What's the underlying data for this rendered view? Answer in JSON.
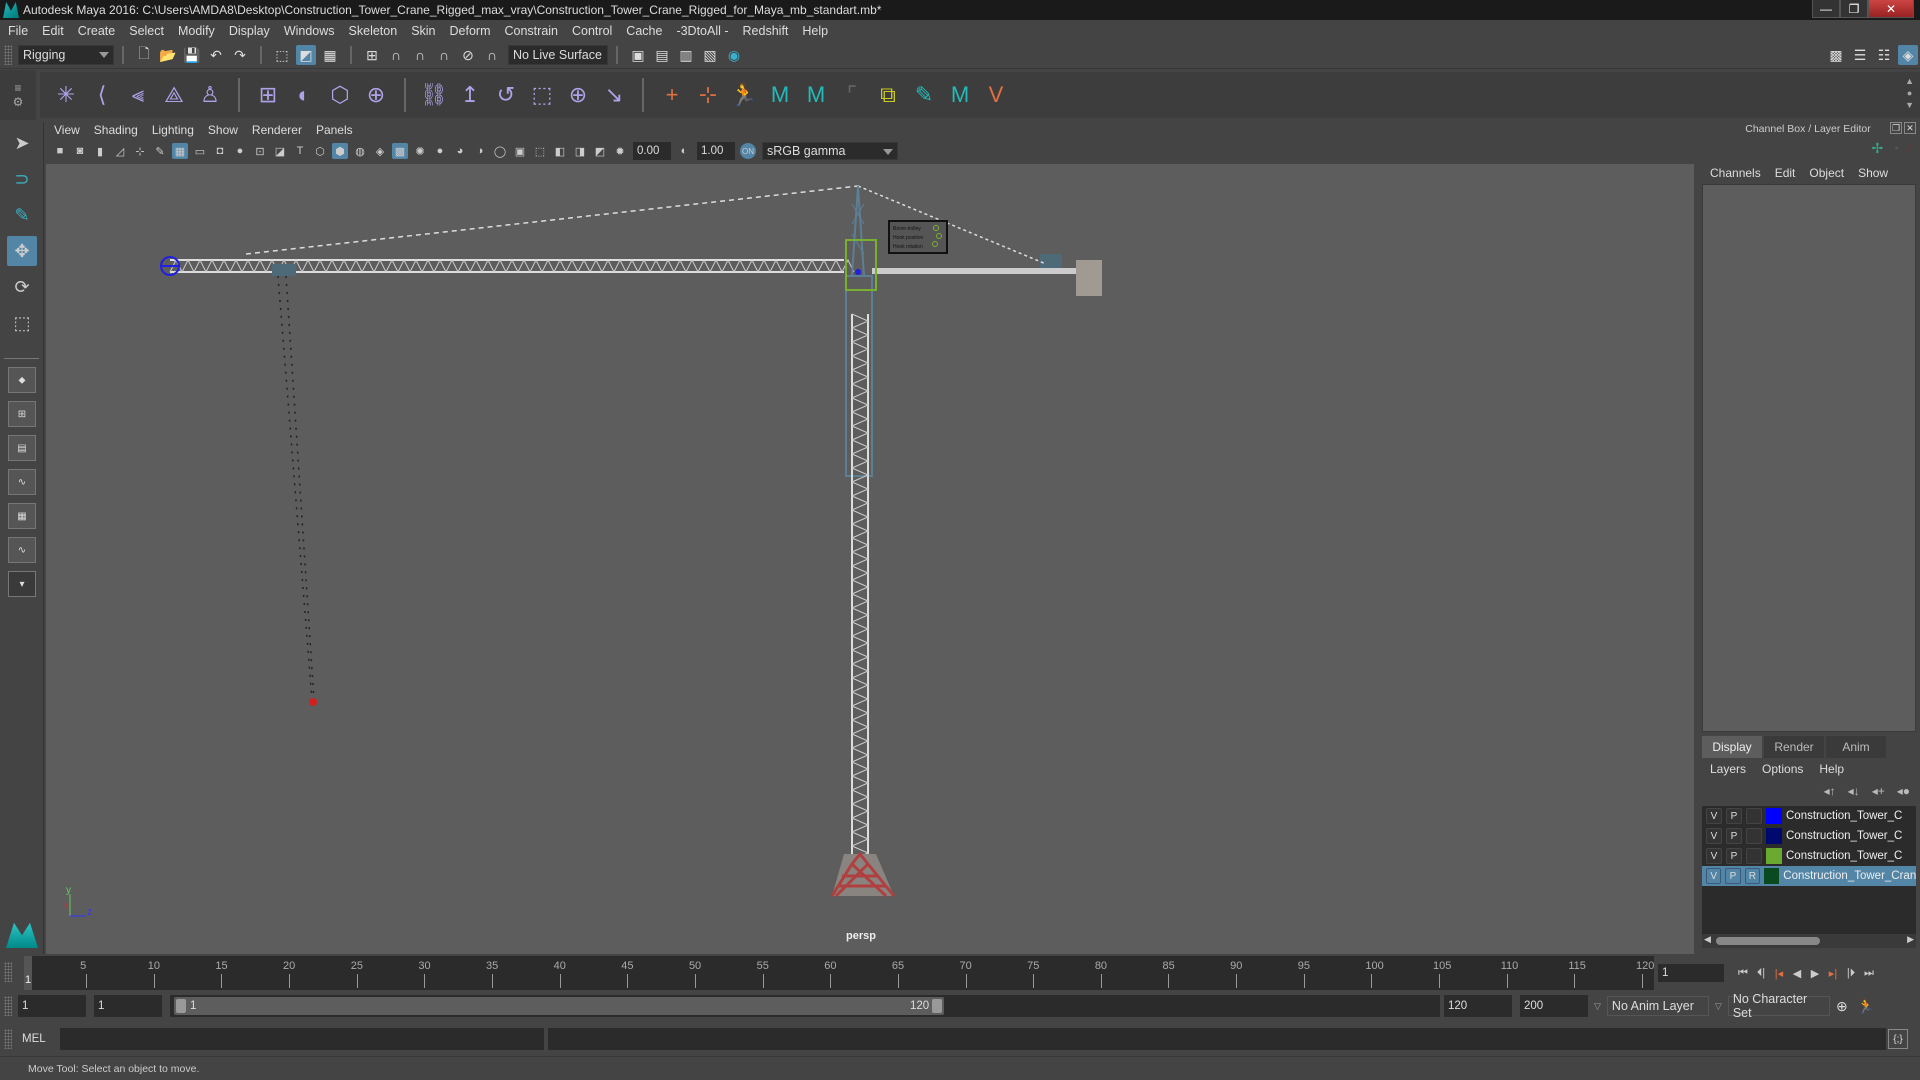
{
  "window": {
    "title": "Autodesk Maya 2016: C:\\Users\\AMDA8\\Desktop\\Construction_Tower_Crane_Rigged_max_vray\\Construction_Tower_Crane_Rigged_for_Maya_mb_standart.mb*",
    "minimize": "—",
    "maximize": "❐",
    "close": "✕"
  },
  "menubar": [
    "File",
    "Edit",
    "Create",
    "Select",
    "Modify",
    "Display",
    "Windows",
    "Skeleton",
    "Skin",
    "Deform",
    "Constrain",
    "Control",
    "Cache",
    "-3DtoAll -",
    "Redshift",
    "Help"
  ],
  "statusline": {
    "menuset": "Rigging",
    "live_surface": "No Live Surface",
    "icons": [
      "new-scene-icon",
      "open-scene-icon",
      "save-scene-icon",
      "undo-icon",
      "redo-icon",
      "select-hierarchy-icon",
      "select-object-icon",
      "select-component-icon",
      "snap-grid-icon",
      "snap-curve-icon",
      "snap-point-icon",
      "snap-view-plane-icon",
      "snap-live-icon",
      "snap-surface-icon",
      "render-view-icon",
      "render-current-icon",
      "ipr-render-icon",
      "render-settings-icon",
      "hypershade-icon"
    ]
  },
  "shelf": {
    "groups": [
      [
        "create-joints-icon",
        "insert-joint-icon",
        "mirror-joint-icon",
        "ik-handle-icon",
        "humanik-icon"
      ],
      [
        "smooth-bind-icon",
        "paint-weights-icon",
        "lattice-icon",
        "cluster-icon"
      ],
      [
        "parent-constraint-icon",
        "point-constraint-icon",
        "orient-constraint-icon",
        "scale-constraint-icon",
        "aim-constraint-icon",
        "pole-vector-icon"
      ],
      [
        "locator-icon",
        "parent-locator-icon",
        "character-icon",
        "maya-logo-icon",
        "maya-logo-icon-2",
        "empty-slot",
        "toggle-visibility-icon",
        "paint-select-icon",
        "maya-logo-icon-3",
        "vertex-icon"
      ]
    ]
  },
  "panel": {
    "menu": [
      "View",
      "Shading",
      "Lighting",
      "Show",
      "Renderer",
      "Panels"
    ],
    "exposure": "0.00",
    "gamma": "1.00",
    "color_space": "sRGB gamma",
    "camera_label": "persp"
  },
  "viewport": {
    "axis": {
      "y": "y",
      "x": "x",
      "z": "z"
    },
    "control_box_labels": [
      "Boom trolley",
      "Hook position",
      "Hook rotation"
    ]
  },
  "channel_box": {
    "title": "Channel Box / Layer Editor",
    "menu": [
      "Channels",
      "Edit",
      "Object",
      "Show"
    ]
  },
  "layer_editor": {
    "tabs": [
      "Display",
      "Render",
      "Anim"
    ],
    "active_tab": "Display",
    "menu": [
      "Layers",
      "Options",
      "Help"
    ],
    "layers": [
      {
        "v": "V",
        "p": "P",
        "r": "",
        "color": "#0000ff",
        "name": "Construction_Tower_C",
        "selected": false
      },
      {
        "v": "V",
        "p": "P",
        "r": "",
        "color": "#000a6e",
        "name": "Construction_Tower_C",
        "selected": false
      },
      {
        "v": "V",
        "p": "P",
        "r": "",
        "color": "#6aaa30",
        "name": "Construction_Tower_C",
        "selected": false
      },
      {
        "v": "V",
        "p": "P",
        "r": "R",
        "color": "#0a4a20",
        "name": "Construction_Tower_Crane",
        "selected": true
      }
    ]
  },
  "timeline": {
    "start": 1,
    "end": 120,
    "ticks": [
      5,
      10,
      15,
      20,
      25,
      30,
      35,
      40,
      45,
      50,
      55,
      60,
      65,
      70,
      75,
      80,
      85,
      90,
      95,
      100,
      105,
      110,
      115,
      120
    ],
    "current_frame_label": "1",
    "current_frame": "1"
  },
  "range": {
    "start_time": "1",
    "playback_start": "1",
    "slider_start": "1",
    "slider_end": "120",
    "playback_end": "120",
    "end_time": "200",
    "anim_layer": "No Anim Layer",
    "character_set": "No Character Set"
  },
  "cmdline": {
    "label": "MEL"
  },
  "helpline": {
    "text": "Move Tool: Select an object to move."
  }
}
